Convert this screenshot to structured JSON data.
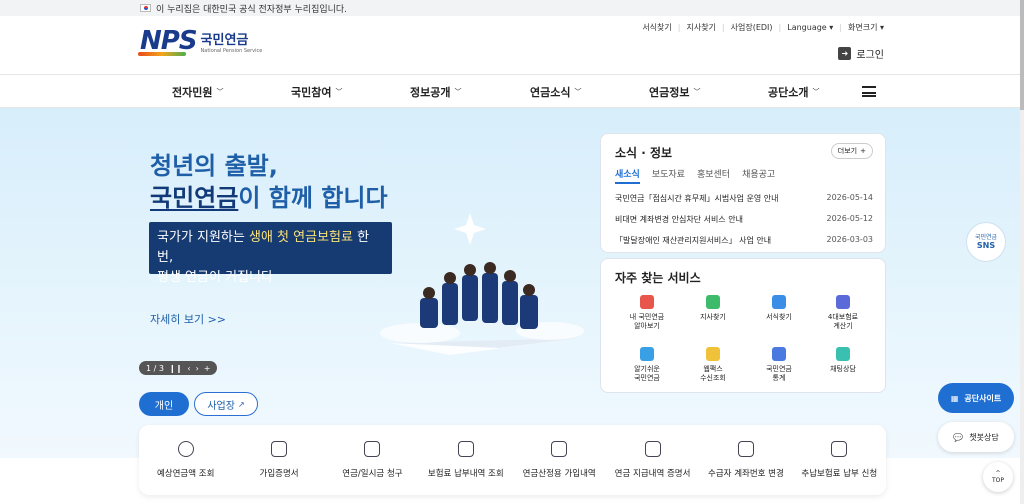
{
  "topbar": {
    "notice": "이 누리집은 대한민국 공식 전자정부 누리집입니다."
  },
  "logo": {
    "mark": "NPS",
    "name": "국민연금",
    "sub": "National Pension Service"
  },
  "util": {
    "links": [
      "서식찾기",
      "지사찾기",
      "사업장(EDI)",
      "Language",
      "화면크기"
    ]
  },
  "login": {
    "label": "로그인"
  },
  "nav": {
    "items": [
      "전자민원",
      "국민참여",
      "정보공개",
      "연금소식",
      "연금정보",
      "공단소개"
    ]
  },
  "hero": {
    "title_line1": "청년의 출발,",
    "title_u": "국민연금",
    "title_rest": "이 함께 합니다",
    "box_pre": "국가가 지원하는 ",
    "box_hl": "생애 첫 연금보험료",
    "box_post": " 한번,",
    "box_line2": "평생 연금이 커집니다",
    "more": "자세히 보기 >>",
    "pager": "1 / 3"
  },
  "tabs": {
    "personal": "개인",
    "business": "사업장"
  },
  "news": {
    "title": "소식 · 정보",
    "more": "더보기",
    "tabs": [
      "새소식",
      "보도자료",
      "홍보센터",
      "채용공고"
    ],
    "rows": [
      {
        "t": "국민연금「점심시간 휴무제」시범사업 운영 안내",
        "d": "2026-05-14"
      },
      {
        "t": "비대면 계좌변경 안심차단 서비스 안내",
        "d": "2026-05-12"
      },
      {
        "t": "「발달장애인 재산관리지원서비스」 사업 안내",
        "d": "2026-03-03"
      }
    ]
  },
  "services": {
    "title": "자주 찾는 서비스",
    "items": [
      {
        "l1": "내 국민연금",
        "l2": "알아보기",
        "color": "#e8554a"
      },
      {
        "l1": "지사찾기",
        "l2": "",
        "color": "#3dbb6a"
      },
      {
        "l1": "서식찾기",
        "l2": "",
        "color": "#3a8ee6"
      },
      {
        "l1": "4대보험료",
        "l2": "계산기",
        "color": "#5a6ad8"
      },
      {
        "l1": "알기쉬운",
        "l2": "국민연금",
        "color": "#3aa0e6"
      },
      {
        "l1": "웹팩스",
        "l2": "수신조회",
        "color": "#f0c23a"
      },
      {
        "l1": "국민연금",
        "l2": "통계",
        "color": "#4a7ae0"
      },
      {
        "l1": "채팅상담",
        "l2": "",
        "color": "#39c0b0"
      }
    ]
  },
  "quick": {
    "items": [
      "예상연금액 조회",
      "가입증명서",
      "연금/일시금 청구",
      "보험료 납부내역 조회",
      "연금산정용 가입내역",
      "연금 지급내역 증명서",
      "수급자 계좌번호 변경",
      "추납보험료 납부 신청"
    ]
  },
  "side": {
    "site": "공단사이트",
    "chat": "챗봇상담",
    "top": "TOP",
    "sns_l1": "국민연금",
    "sns_l2": "SNS"
  }
}
